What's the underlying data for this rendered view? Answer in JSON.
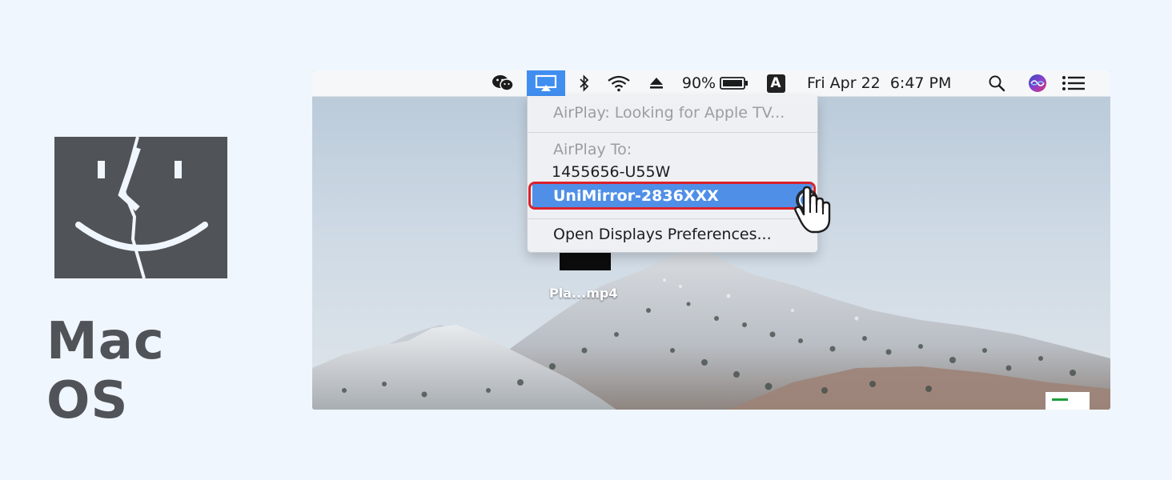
{
  "brand": {
    "os_name": "Mac OS",
    "logo_icon": "finder-face-icon",
    "logo_color": "#505357"
  },
  "menubar": {
    "icons": [
      "wechat-icon",
      "airplay-icon",
      "bluetooth-icon",
      "wifi-icon",
      "eject-icon",
      "battery-icon",
      "input-source-icon",
      "search-icon",
      "siri-icon",
      "notification-center-icon"
    ],
    "battery_percent": "90%",
    "input_source_letter": "A",
    "datetime": "Fri Apr 22  6:47 PM",
    "airplay_active_color": "#3f8ef0"
  },
  "airplay_menu": {
    "status": "AirPlay: Looking for Apple TV...",
    "section_label": "AirPlay To:",
    "devices": [
      "1455656-U55W",
      "UniMirror-2836XXX"
    ],
    "selected_device_color": "#4f8fe8",
    "highlight_frame_color": "#d9222a",
    "preferences_label": "Open Displays Preferences..."
  },
  "desktop": {
    "file_label": "Pla...mp4"
  }
}
